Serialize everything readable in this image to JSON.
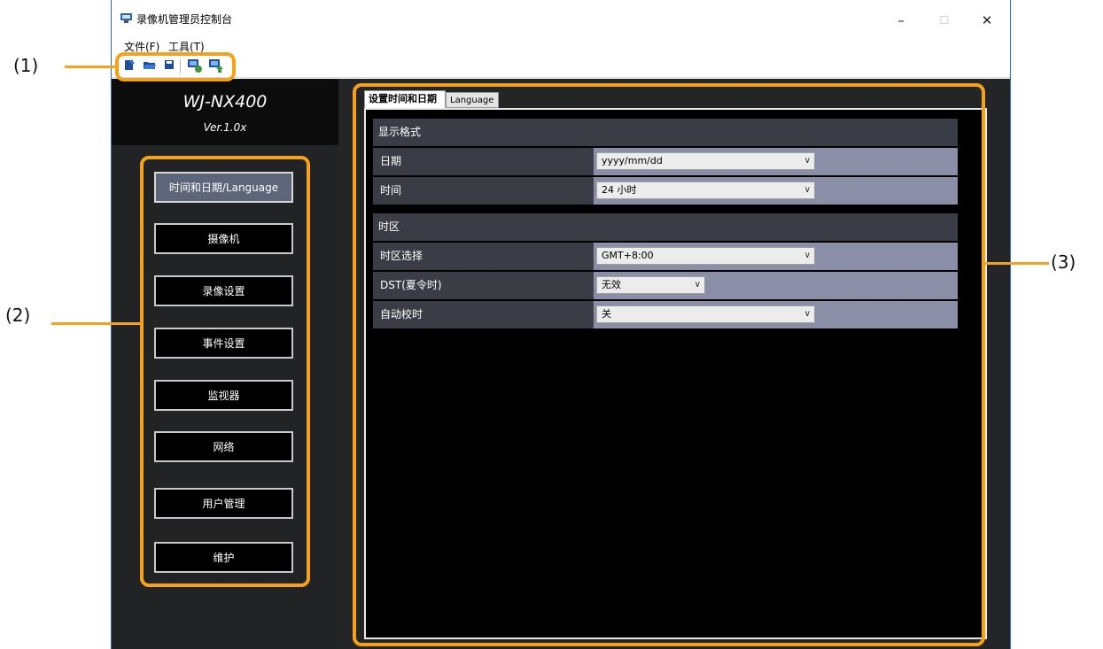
{
  "window": {
    "title": "录像机管理员控制台",
    "minimize": "–",
    "maximize": "☐",
    "close": "✕"
  },
  "menu": {
    "file": "文件(F)",
    "tools": "工具(T)"
  },
  "toolbar_icons": [
    "new-file-icon",
    "open-folder-icon",
    "save-icon",
    "device-config-icon",
    "device-upload-icon"
  ],
  "brand": {
    "model": "WJ-NX400",
    "version": "Ver.1.0x"
  },
  "sidebar": {
    "items": [
      {
        "label": "时间和日期/Language",
        "active": true
      },
      {
        "label": "摄像机"
      },
      {
        "label": "录像设置"
      },
      {
        "label": "事件设置"
      },
      {
        "label": "监视器"
      },
      {
        "label": "网络"
      },
      {
        "label": "用户管理"
      },
      {
        "label": "维护"
      }
    ]
  },
  "tabs": {
    "active": "设置时间和日期",
    "inactive": "Language"
  },
  "form": {
    "display_format": {
      "heading": "显示格式",
      "date_label": "日期",
      "date_value": "yyyy/mm/dd",
      "time_label": "时间",
      "time_value": "24 小时"
    },
    "timezone": {
      "heading": "时区",
      "zone_label": "时区选择",
      "zone_value": "GMT+8:00",
      "dst_label": "DST(夏令时)",
      "dst_value": "无效",
      "auto_label": "自动校时",
      "auto_value": "关"
    }
  },
  "annotations": {
    "one": "(1)",
    "two": "(2)",
    "three": "(3)"
  },
  "colors": {
    "accent": "#f5a21a",
    "sidebar": "#222324",
    "active_button": "#5d6579",
    "row_value": "#8a8ea6"
  }
}
